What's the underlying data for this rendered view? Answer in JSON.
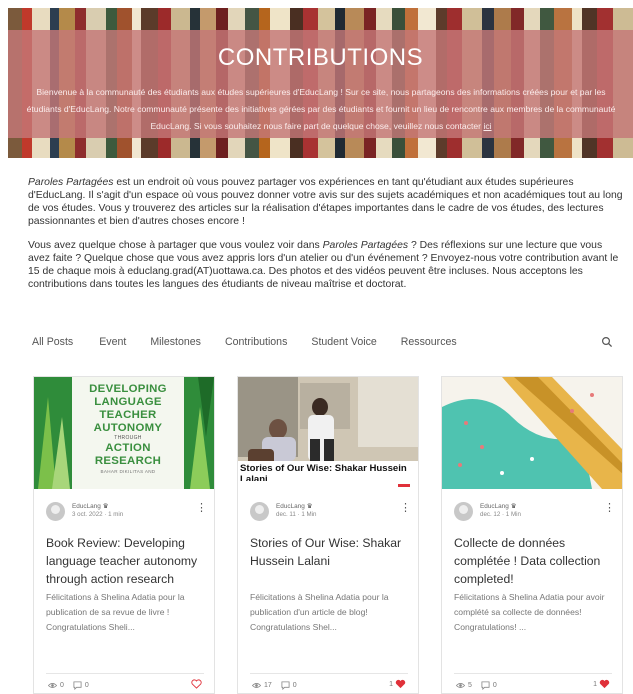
{
  "banner": {
    "title": "CONTRIBUTIONS",
    "text": "Bienvenue à la communauté des étudiants aux études supérieures d'EducLang ! Sur ce site, nous partageons des informations créées pour et par les étudiants d'EducLang. Notre communauté présente des initiatives gérées par des étudiants et fournit un lieu de rencontre aux membres de la communauté EducLang. Si vous souhaitez nous faire part de quelque chose, veuillez nous contacter",
    "link_label": "ici"
  },
  "intro": {
    "p1_em": "Paroles Partagées",
    "p1_text": " est un endroit où vous pouvez partager vos expériences en tant qu'étudiant aux études supérieures d'EducLang. Il s'agit d'un espace où vous pouvez donner votre avis sur des sujets académiques et non académiques tout au long de vos études. Vous y trouverez des articles sur la réalisation d'étapes importantes dans le cadre de vos études, des lectures passionnantes et bien d'autres choses encore !",
    "p2_a": "Vous avez quelque chose à partager que vous voulez voir dans ",
    "p2_em": "Paroles Partagées",
    "p2_b": " ? Des réflexions sur une lecture que vous avez faite ? Quelque chose que vous avez appris lors d'un atelier ou d'un événement ? Envoyez-nous votre contribution avant le 15 de chaque mois à educlang.grad(AT)uottawa.ca. Des photos et des vidéos peuvent être incluses. Nous acceptons les contributions dans toutes les langues des étudiants de niveau maîtrise et doctorat."
  },
  "nav": {
    "items": [
      "All Posts",
      "Event",
      "Milestones",
      "Contributions",
      "Student Voice",
      "Ressources"
    ]
  },
  "cards": [
    {
      "book_title_lines": [
        "DEVELOPING",
        "LANGUAGE",
        "TEACHER",
        "AUTONOMY"
      ],
      "book_through": "THROUGH",
      "book_subtitle_lines": [
        "ACTION",
        "RESEARCH"
      ],
      "book_author": "BAHAR DIKILITAS AND",
      "author": "EducLang",
      "date": "3 oct. 2022 · 1 min",
      "title": "Book Review: Developing language teacher autonomy through action research",
      "excerpt": "Félicitations à Shelina Adatia pour la publication de sa revue de livre ! Congratulations Sheli...",
      "views": "0",
      "comments": "0",
      "likes": ""
    },
    {
      "image_caption": "Stories of Our Wise: Shakar Hussein Lalani",
      "author": "EducLang",
      "date": "dec. 11 · 1 Min",
      "title": "Stories of Our Wise: Shakar Hussein Lalani",
      "excerpt": "Félicitations à Shelina Adatia pour la publication d'un article de blog! Congratulations Shel...",
      "views": "17",
      "comments": "0",
      "likes": "1"
    },
    {
      "author": "EducLang",
      "date": "dec. 12 · 1 Min",
      "title": "Collecte de données complétée ! Data collection completed!",
      "excerpt": "Félicitations à Shelina Adatia pour avoir complété sa collecte de données! Congratulations! ...",
      "views": "5",
      "comments": "0",
      "likes": "1"
    }
  ],
  "colors": {
    "banner_overlay": "#c47878",
    "heart": "#e0313a",
    "book_green": "#2f8c3a"
  }
}
